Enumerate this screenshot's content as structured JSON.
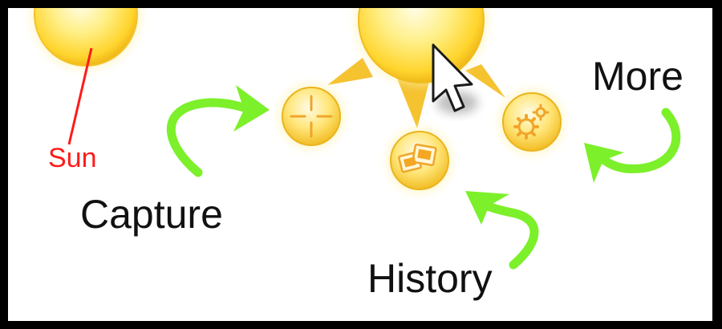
{
  "labels": {
    "sun": "Sun",
    "capture": "Capture",
    "history": "History",
    "more": "More"
  },
  "icons": {
    "sun": "sun-icon",
    "main": "sun-main-icon",
    "capture": "crosshair-icon",
    "history": "photos-icon",
    "more": "gear-icon",
    "cursor": "mouse-pointer-icon"
  },
  "colors": {
    "sun_fill": "#ffd83a",
    "sun_highlight": "#fffbe0",
    "sun_rim": "#e9b415",
    "arrow": "#7cf02a",
    "sun_label": "#ff1a1a",
    "text": "#111111"
  }
}
